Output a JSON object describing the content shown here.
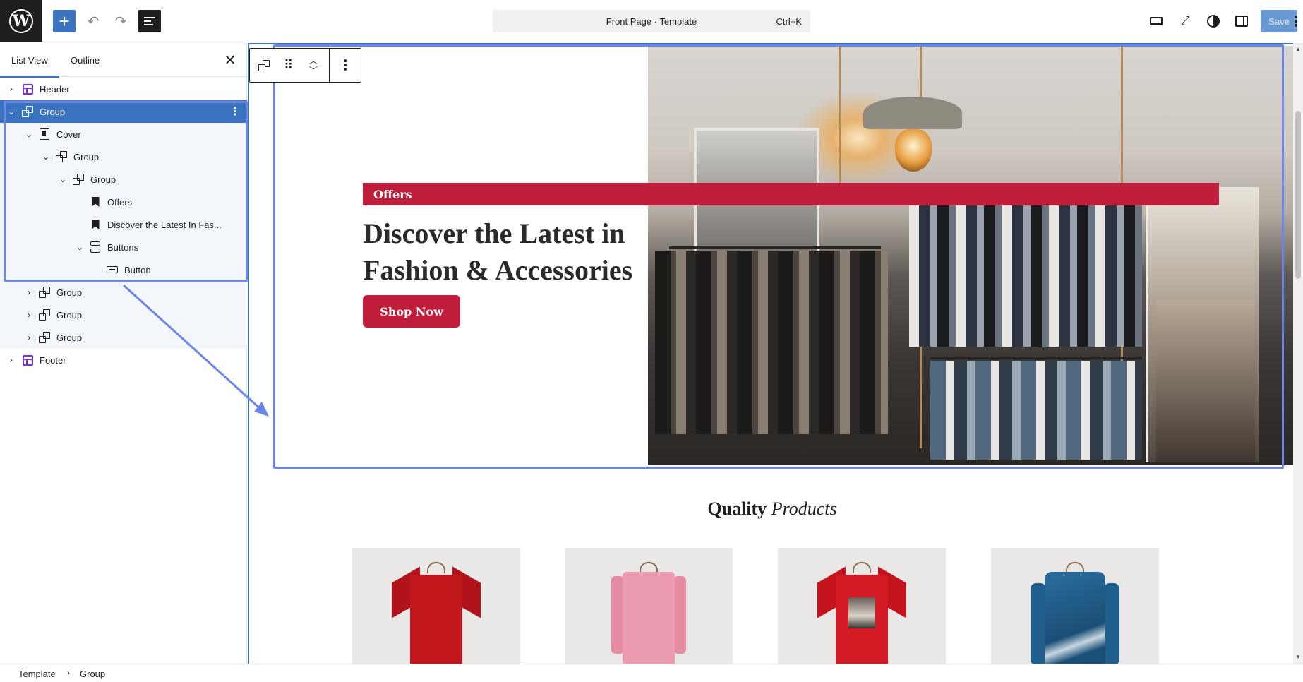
{
  "topbar": {
    "add_label": "+",
    "undo_icon": "undo-icon",
    "redo_icon": "redo-icon",
    "document_title": "Front Page · Template",
    "shortcut": "Ctrl+K",
    "save_label": "Save",
    "accent_color": "#3a73c0"
  },
  "panel": {
    "tabs": [
      {
        "label": "List View",
        "active": true
      },
      {
        "label": "Outline",
        "active": false
      }
    ],
    "close_label": "✕",
    "tree": [
      {
        "label": "Header",
        "icon": "template-part-icon",
        "expanded": false
      },
      {
        "label": "Group",
        "icon": "group-icon",
        "expanded": true,
        "selected": true
      },
      {
        "label": "Cover",
        "icon": "cover-icon",
        "expanded": true
      },
      {
        "label": "Group",
        "icon": "group-icon",
        "expanded": true
      },
      {
        "label": "Group",
        "icon": "group-icon",
        "expanded": true
      },
      {
        "label": "Offers",
        "icon": "heading-bookmark-icon"
      },
      {
        "label": "Discover the Latest In Fas...",
        "icon": "heading-bookmark-icon"
      },
      {
        "label": "Buttons",
        "icon": "buttons-icon",
        "expanded": true
      },
      {
        "label": "Button",
        "icon": "button-icon"
      },
      {
        "label": "Group",
        "icon": "group-icon",
        "expanded": false
      },
      {
        "label": "Group",
        "icon": "group-icon",
        "expanded": false
      },
      {
        "label": "Group",
        "icon": "group-icon",
        "expanded": false
      },
      {
        "label": "Footer",
        "icon": "template-part-icon",
        "expanded": false
      }
    ]
  },
  "canvas": {
    "offers_label": "Offers",
    "hero_title": "Discover the Latest in Fashion & Accessories",
    "shop_button": "Shop Now",
    "section_title_bold": "Quality",
    "section_title_italic": "Products",
    "brand_color": "#c01d3b",
    "products": [
      {
        "item": "red-tshirt"
      },
      {
        "item": "pink-coat"
      },
      {
        "item": "red-graphic-tshirt"
      },
      {
        "item": "blue-ski-jacket"
      }
    ]
  },
  "footer": {
    "breadcrumb": [
      "Template",
      "Group"
    ]
  }
}
